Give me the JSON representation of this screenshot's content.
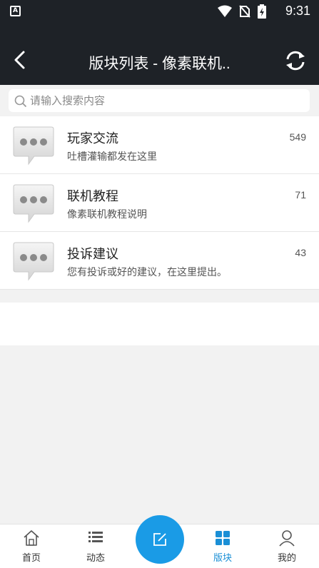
{
  "status_bar": {
    "app_badge": "A",
    "time": "9:31",
    "icons": [
      "wifi-icon",
      "no-sim-icon",
      "battery-charging-icon"
    ]
  },
  "app_bar": {
    "title": "版块列表 - 像素联机..",
    "back_icon": "arrow-left-icon",
    "refresh_icon": "refresh-icon"
  },
  "search": {
    "placeholder": "请输入搜索内容",
    "value": ""
  },
  "forums": [
    {
      "name": "玩家交流",
      "desc": "吐槽灌输都发在这里",
      "count": "549",
      "icon": "chat-bubble-icon"
    },
    {
      "name": "联机教程",
      "desc": "像素联机教程说明",
      "count": "71",
      "icon": "chat-bubble-icon"
    },
    {
      "name": "投诉建议",
      "desc": "您有投诉或好的建议，在这里提出。",
      "count": "43",
      "icon": "chat-bubble-icon"
    }
  ],
  "bottom_nav": {
    "items": [
      {
        "label": "首页",
        "icon": "home-icon",
        "active": false
      },
      {
        "label": "动态",
        "icon": "list-icon",
        "active": false
      },
      {
        "label": "版块",
        "icon": "grid-icon",
        "active": true
      },
      {
        "label": "我的",
        "icon": "user-icon",
        "active": false
      }
    ],
    "fab_icon": "edit-icon"
  },
  "colors": {
    "header_bg": "#1e2227",
    "accent": "#1a9be6",
    "page_bg": "#f2f2f2"
  }
}
